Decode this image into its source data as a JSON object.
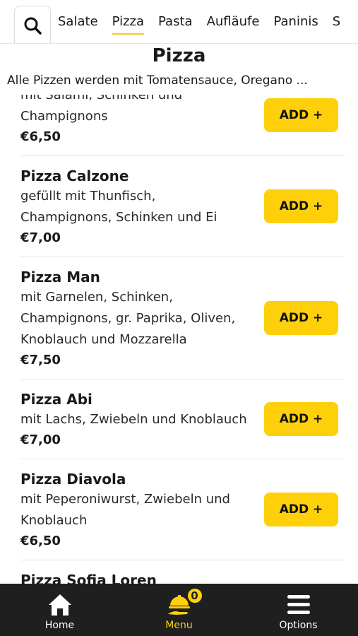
{
  "categories": {
    "items": [
      {
        "label": "Salate"
      },
      {
        "label": "Pizza"
      },
      {
        "label": "Pasta"
      },
      {
        "label": "Aufläufe"
      },
      {
        "label": "Paninis"
      },
      {
        "label": "S"
      }
    ],
    "active_index": 1
  },
  "section": {
    "title": "Pizza",
    "description": "Alle Pizzen werden mit Tomatensauce, Oregano ..."
  },
  "menu_items": [
    {
      "name": "",
      "desc_lines": [
        "mit Salami, Schinken und",
        "Champignons"
      ],
      "price": "€6,50",
      "add_label": "ADD +"
    },
    {
      "name": "Pizza Calzone",
      "desc_lines": [
        "gefüllt mit Thunfisch,",
        "Champignons, Schinken und Ei"
      ],
      "price": "€7,00",
      "add_label": "ADD +"
    },
    {
      "name": "Pizza Man",
      "desc_lines": [
        "mit Garnelen, Schinken,",
        "Champignons, gr. Paprika, Oliven,",
        "Knoblauch und Mozzarella"
      ],
      "price": "€7,50",
      "add_label": "ADD +"
    },
    {
      "name": "Pizza Abi",
      "desc_lines": [
        "mit Lachs, Zwiebeln und Knoblauch"
      ],
      "price": "€7,00",
      "add_label": "ADD +"
    },
    {
      "name": "Pizza Diavola",
      "desc_lines": [
        "mit Peperoniwurst, Zwiebeln und",
        "Knoblauch"
      ],
      "price": "€6,50",
      "add_label": "ADD +"
    },
    {
      "name": "Pizza Sofia Loren",
      "desc_lines": [],
      "price": "",
      "add_label": ""
    }
  ],
  "bottom_nav": {
    "home_label": "Home",
    "menu_label": "Menu",
    "options_label": "Options",
    "cart_count": "0"
  },
  "colors": {
    "accent": "#fed00a",
    "nav_bg": "#1f1f1f"
  },
  "icons": [
    "search-icon",
    "home-icon",
    "food-service-icon",
    "menu-lines-icon"
  ]
}
